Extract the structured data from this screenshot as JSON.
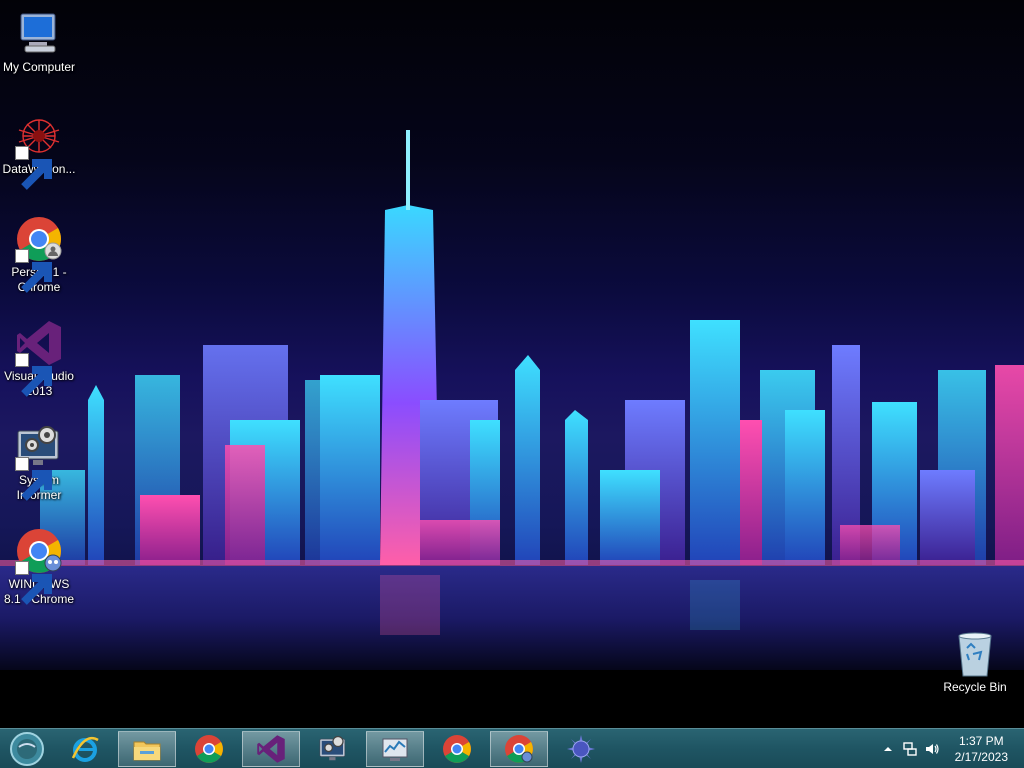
{
  "desktop_icons": [
    {
      "label": "My Computer",
      "icon": "computer-icon"
    },
    {
      "label": "DataWagon...",
      "icon": "datawagon-icon"
    },
    {
      "label": "Person 1 - Chrome",
      "icon": "chrome-icon"
    },
    {
      "label": "Visual Studio 2013",
      "icon": "visual-studio-icon"
    },
    {
      "label": "System Informer",
      "icon": "system-informer-icon"
    },
    {
      "label": "WINDOWS 8.1 - Chrome",
      "icon": "chrome-icon"
    },
    {
      "label": "Recycle Bin",
      "icon": "recycle-bin-icon"
    }
  ],
  "taskbar": {
    "pinned": [
      {
        "name": "internet-explorer",
        "icon": "internet-explorer-icon",
        "active": false
      },
      {
        "name": "file-explorer",
        "icon": "folder-icon",
        "active": true
      },
      {
        "name": "chrome",
        "icon": "chrome-icon",
        "active": false
      },
      {
        "name": "visual-studio",
        "icon": "visual-studio-icon",
        "active": true
      },
      {
        "name": "system-informer",
        "icon": "system-informer-icon",
        "active": false
      },
      {
        "name": "resource-monitor",
        "icon": "resource-monitor-icon",
        "active": true
      },
      {
        "name": "chrome-2",
        "icon": "chrome-icon",
        "active": false
      },
      {
        "name": "chrome-windows81",
        "icon": "chrome-icon",
        "active": true
      },
      {
        "name": "network-tool",
        "icon": "spiky-ball-icon",
        "active": false
      }
    ]
  },
  "clock": {
    "time": "1:37 PM",
    "date": "2/17/2023"
  },
  "colors": {
    "taskbar": "#1f5563",
    "accent": "#22d3ee",
    "magenta": "#ff3fa4"
  }
}
